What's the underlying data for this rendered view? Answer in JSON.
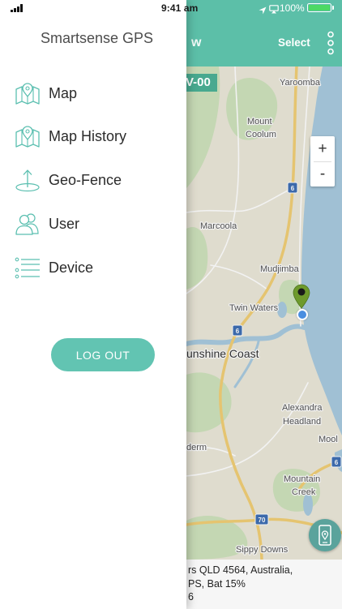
{
  "status_bar": {
    "time": "9:41 am",
    "battery_text": "100%",
    "battery_level": 1.0,
    "icons": [
      "signal-icon",
      "location-arrow-icon",
      "screen-mirroring-icon",
      "battery-icon"
    ]
  },
  "drawer": {
    "title": "Smartsense GPS",
    "items": [
      {
        "label": "Map",
        "icon": "map-pin-icon"
      },
      {
        "label": "Map History",
        "icon": "map-pin-icon"
      },
      {
        "label": "Geo-Fence",
        "icon": "geofence-icon"
      },
      {
        "label": "User",
        "icon": "users-icon"
      },
      {
        "label": "Device",
        "icon": "list-icon"
      }
    ],
    "logout_label": "LOG OUT"
  },
  "header": {
    "title_fragment": "w",
    "select_label": "Select",
    "menu_icon": "more-vertical-icon"
  },
  "map": {
    "vehicle_tag": "V-00",
    "places": [
      {
        "lines": [
          "Yaroomba"
        ]
      },
      {
        "lines": [
          "Mount",
          "Coolum"
        ]
      },
      {
        "lines": [
          "Marcoola"
        ]
      },
      {
        "lines": [
          "Mudjimba"
        ]
      },
      {
        "lines": [
          "Twin Waters"
        ]
      },
      {
        "lines": [
          "unshine Coast"
        ]
      },
      {
        "lines": [
          "Alexandra",
          "Headland"
        ]
      },
      {
        "lines": [
          "Mool"
        ]
      },
      {
        "lines": [
          "derm"
        ]
      },
      {
        "lines": [
          "Mountain",
          "Creek"
        ]
      },
      {
        "lines": [
          "Sippy Downs"
        ]
      }
    ],
    "road_shields": [
      "6",
      "6",
      "70",
      "6"
    ],
    "zoom_in_label": "+",
    "zoom_out_label": "-",
    "markers": [
      "vehicle-pin-icon",
      "current-location-dot"
    ],
    "locate_button_icon": "phone-location-icon"
  },
  "info_panel": {
    "lines": [
      "rs QLD 4564, Australia,",
      "PS, Bat 15%",
      "6"
    ]
  },
  "colors": {
    "teal": "#5cbfa8",
    "logout_button": "#62c4b2",
    "icon_teal": "#5bbfb0",
    "battery_green": "#4cd964",
    "pin_green": "#6e9a2c",
    "location_blue": "#4a8ee0",
    "tag_teal": "#48a98f",
    "locate_button": "#5aa39c"
  }
}
